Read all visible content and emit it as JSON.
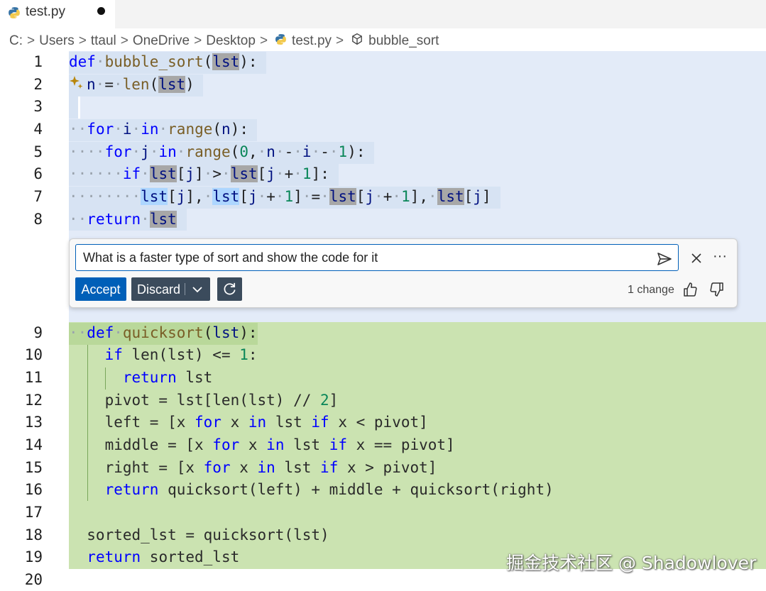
{
  "tab": {
    "filename": "test.py",
    "unsaved": true
  },
  "breadcrumb": [
    "C:",
    "Users",
    "ttaul",
    "OneDrive",
    "Desktop",
    "test.py",
    "bubble_sort"
  ],
  "line_numbers": [
    "1",
    "2",
    "3",
    "4",
    "5",
    "6",
    "7",
    "8",
    "9",
    "10",
    "11",
    "12",
    "13",
    "14",
    "15",
    "16",
    "17",
    "18",
    "19",
    "20"
  ],
  "chat": {
    "prompt": "What is a faster type of sort and show the code for it",
    "accept_label": "Accept",
    "discard_label": "Discard",
    "change_count": "1 change",
    "more_label": "···"
  },
  "watermark": "掘金技术社区 @ Shadowlover",
  "colors": {
    "accent": "#005fb8",
    "secondary_button": "#3b4b5c",
    "selection_band": "#e3ebf8",
    "added_band": "#cbe3b1",
    "keyword": "#0000ff"
  },
  "icons": [
    "python-icon",
    "symbol-method-icon",
    "sparkle-icon",
    "send-icon",
    "close-icon",
    "chevron-down-icon",
    "refresh-icon",
    "thumbs-up-icon",
    "thumbs-down-icon"
  ]
}
